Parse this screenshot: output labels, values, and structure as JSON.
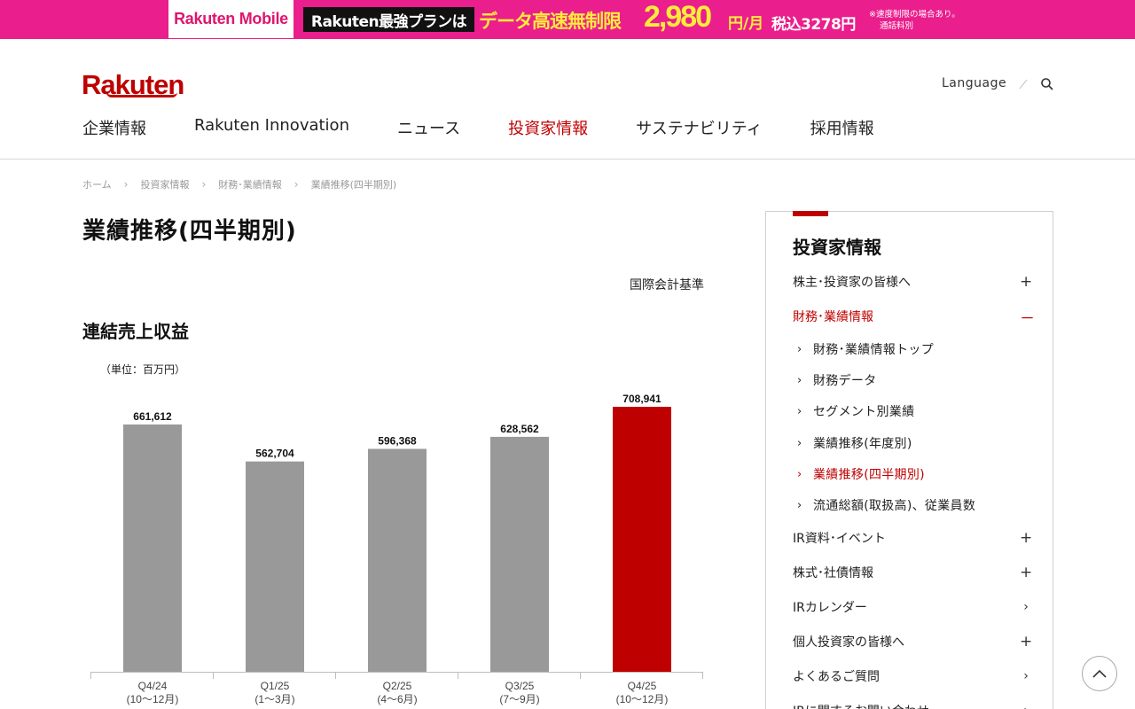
{
  "banner": {
    "brand": "Rakuten Mobile",
    "plan": "Rakuten最強プランは",
    "speed": "データ高速無制限",
    "price": "2,980",
    "per": "円/月",
    "tax": "税込3278円",
    "note_line1": "※速度制限の場合あり。",
    "note_line2": "通話料別"
  },
  "header": {
    "logo": "Rakuten",
    "language": "Language",
    "nav": [
      "企業情報",
      "Rakuten Innovation",
      "ニュース",
      "投資家情報",
      "サステナビリティ",
      "採用情報"
    ],
    "nav_active_index": 3
  },
  "breadcrumb": [
    "ホーム",
    "投資家情報",
    "財務･業績情報",
    "業績推移(四半期別)"
  ],
  "main": {
    "title": "業績推移(四半期別)",
    "standard": "国際会計基準",
    "section_title": "連結売上収益",
    "unit": "（単位：百万円）"
  },
  "chart_data": {
    "type": "bar",
    "title": "連結売上収益",
    "unit": "（単位：百万円）",
    "categories": [
      "Q4/24",
      "Q1/25",
      "Q2/25",
      "Q3/25",
      "Q4/25"
    ],
    "category_sublabels": [
      "(10～12月)",
      "(1～3月)",
      "(4～6月)",
      "(7～9月)",
      "(10～12月)"
    ],
    "values": [
      661612,
      562704,
      596368,
      628562,
      708941
    ],
    "value_labels": [
      "661,612",
      "562,704",
      "596,368",
      "628,562",
      "708,941"
    ],
    "highlight_index": 4,
    "colors": {
      "bar": "#999999",
      "highlight": "#bf0000"
    },
    "ylim": [
      0,
      708941
    ],
    "grid": false
  },
  "sidebar": {
    "title": "投資家情報",
    "items": [
      {
        "label": "株主･投資家の皆様へ",
        "toggle": "+"
      },
      {
        "label": "財務･業績情報",
        "toggle": "－"
      },
      {
        "label": "IR資料･イベント",
        "toggle": "+"
      },
      {
        "label": "株式･社債情報",
        "toggle": "+"
      },
      {
        "label": "IRカレンダー",
        "toggle": "›"
      },
      {
        "label": "個人投資家の皆様へ",
        "toggle": "+"
      },
      {
        "label": "よくあるご質問",
        "toggle": "›"
      },
      {
        "label": "IRに関するお問い合わせ",
        "toggle": "›"
      }
    ],
    "sub_items": [
      "財務･業績情報トップ",
      "財務データ",
      "セグメント別業績",
      "業績推移(年度別)",
      "業績推移(四半期別)",
      "流通総額(取扱高)、従業員数"
    ],
    "sub_current_index": 4
  },
  "colors": {
    "brand": "#bf0000",
    "banner": "#ea1e8c"
  }
}
